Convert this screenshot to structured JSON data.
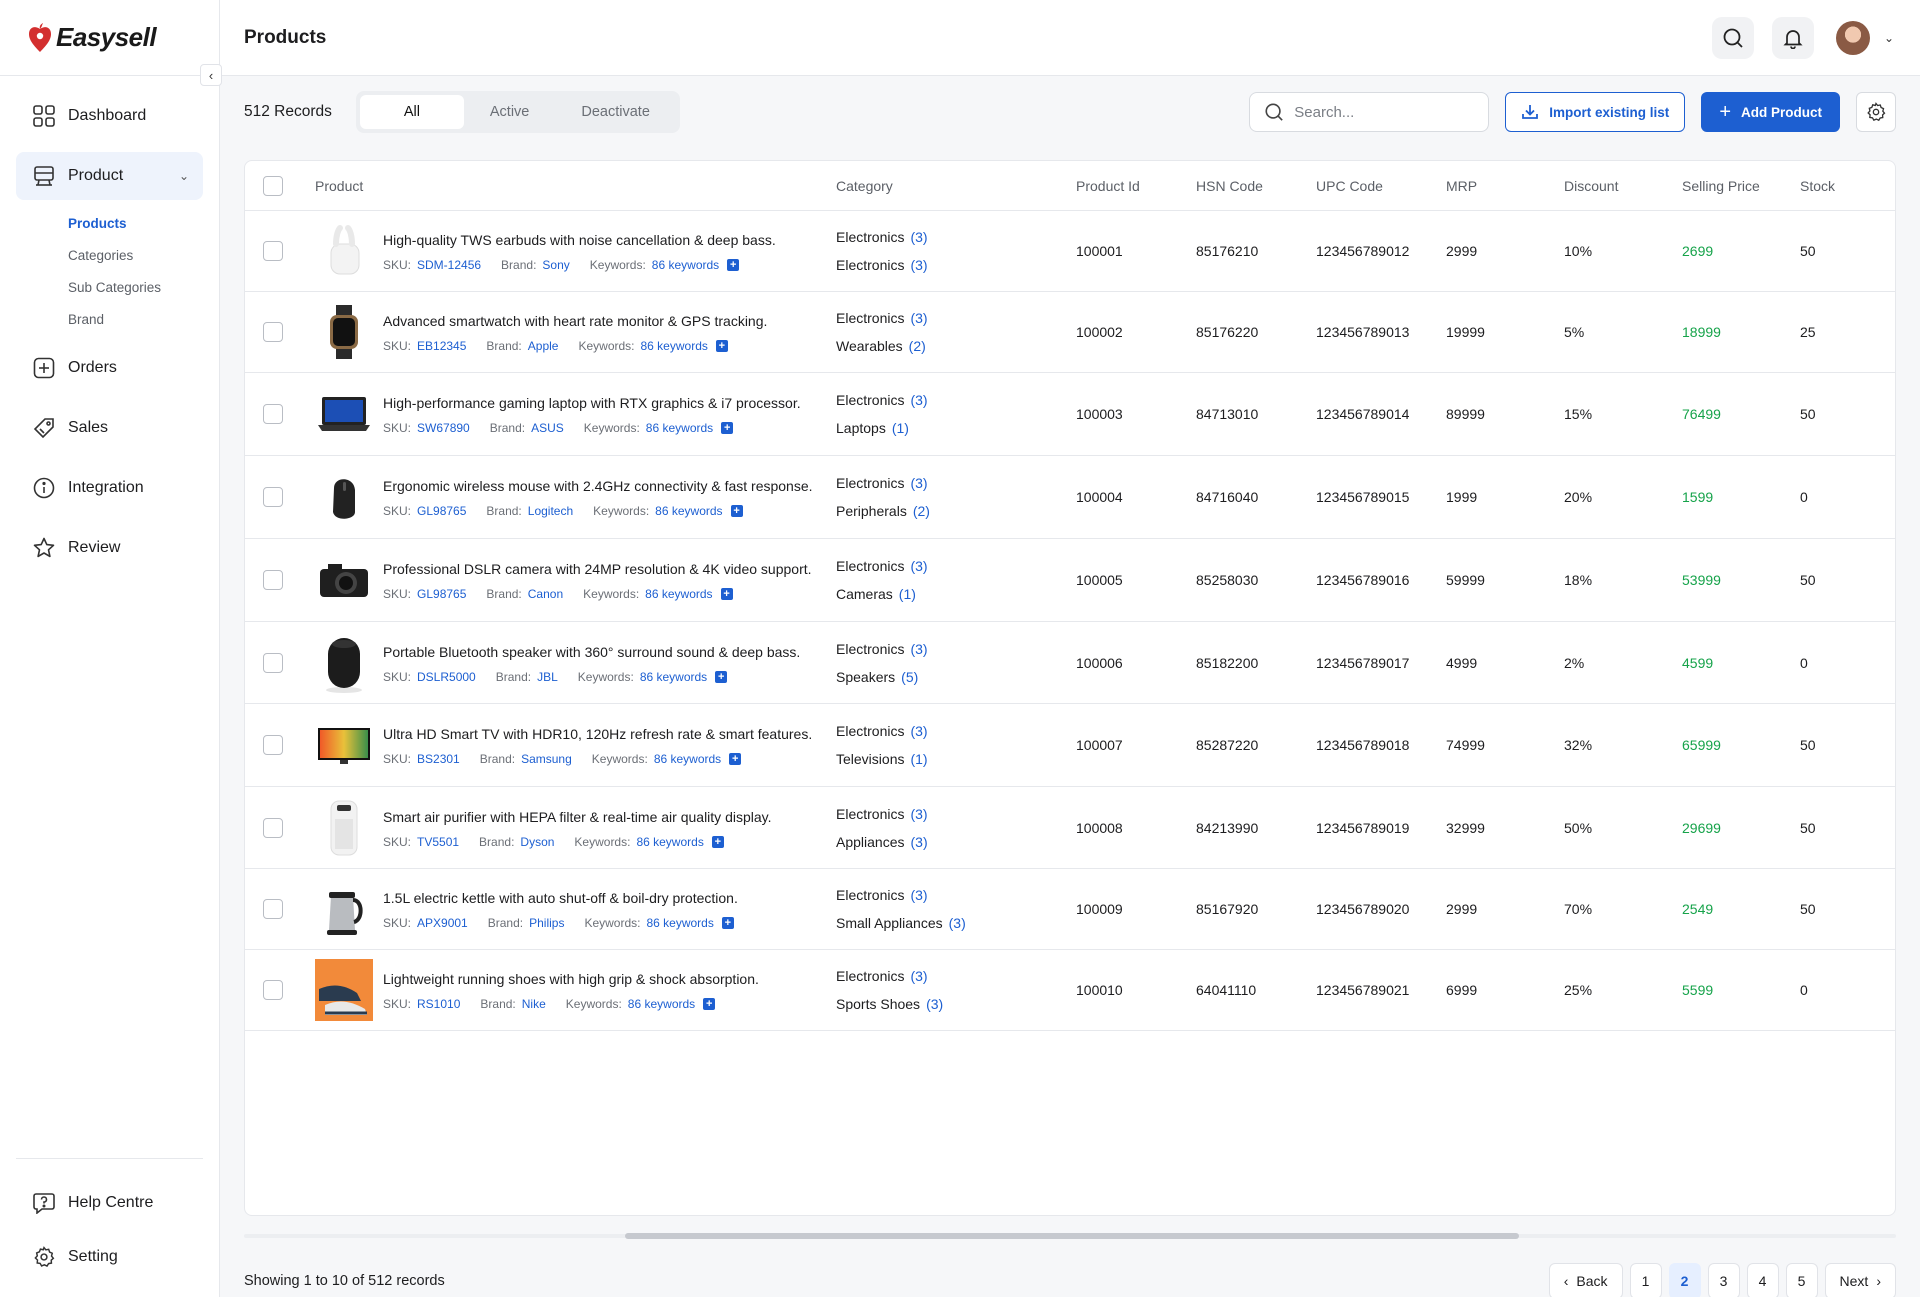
{
  "app": {
    "name": "Easysell",
    "page_title": "Products"
  },
  "sidebar": {
    "items": [
      {
        "label": "Dashboard",
        "icon": "grid-icon"
      },
      {
        "label": "Product",
        "icon": "product-icon"
      },
      {
        "label": "Orders",
        "icon": "plus-square-icon"
      },
      {
        "label": "Sales",
        "icon": "tag-icon"
      },
      {
        "label": "Integration",
        "icon": "info-icon"
      },
      {
        "label": "Review",
        "icon": "star-icon"
      }
    ],
    "product_sub": [
      "Products",
      "Categories",
      "Sub Categories",
      "Brand"
    ],
    "bottom": [
      {
        "label": "Help Centre",
        "icon": "help-icon"
      },
      {
        "label": "Setting",
        "icon": "gear-icon"
      }
    ]
  },
  "toolbar": {
    "records": "512 Records",
    "filters": [
      "All",
      "Active",
      "Deactivate"
    ],
    "search_placeholder": "Search...",
    "import_label": "Import existing list",
    "add_label": "Add Product"
  },
  "table": {
    "headers": [
      "Product",
      "Category",
      "Product Id",
      "HSN Code",
      "UPC Code",
      "MRP",
      "Discount",
      "Selling Price",
      "Stock"
    ],
    "meta_labels": {
      "sku": "SKU:",
      "brand": "Brand:",
      "keywords": "Keywords:"
    },
    "rows": [
      {
        "name": "High-quality TWS earbuds with noise cancellation & deep bass.",
        "sku": "SDM-12456",
        "brand": "Sony",
        "keywords": "86 keywords",
        "cat1": "Electronics",
        "cnt1": "(3)",
        "cat2": "Electronics",
        "cnt2": "(3)",
        "pid": "100001",
        "hsn": "85176210",
        "upc": "123456789012",
        "mrp": "2999",
        "disc": "10%",
        "sell": "2699",
        "stock": "50"
      },
      {
        "name": "Advanced smartwatch with heart rate monitor & GPS tracking.",
        "sku": "EB12345",
        "brand": "Apple",
        "keywords": "86 keywords",
        "cat1": "Electronics",
        "cnt1": "(3)",
        "cat2": "Wearables",
        "cnt2": "(2)",
        "pid": "100002",
        "hsn": "85176220",
        "upc": "123456789013",
        "mrp": "19999",
        "disc": "5%",
        "sell": "18999",
        "stock": "25"
      },
      {
        "name": "High-performance gaming laptop with RTX graphics & i7 processor.",
        "sku": "SW67890",
        "brand": "ASUS",
        "keywords": "86 keywords",
        "cat1": "Electronics",
        "cnt1": "(3)",
        "cat2": "Laptops",
        "cnt2": "(1)",
        "pid": "100003",
        "hsn": "84713010",
        "upc": "123456789014",
        "mrp": "89999",
        "disc": "15%",
        "sell": "76499",
        "stock": "50"
      },
      {
        "name": "Ergonomic wireless mouse with 2.4GHz connectivity & fast response.",
        "sku": "GL98765",
        "brand": "Logitech",
        "keywords": "86 keywords",
        "cat1": "Electronics",
        "cnt1": "(3)",
        "cat2": "Peripherals",
        "cnt2": "(2)",
        "pid": "100004",
        "hsn": "84716040",
        "upc": "123456789015",
        "mrp": "1999",
        "disc": "20%",
        "sell": "1599",
        "stock": "0"
      },
      {
        "name": "Professional DSLR camera with 24MP resolution & 4K video support.",
        "sku": "GL98765",
        "brand": "Canon",
        "keywords": "86 keywords",
        "cat1": "Electronics",
        "cnt1": "(3)",
        "cat2": "Cameras",
        "cnt2": "(1)",
        "pid": "100005",
        "hsn": "85258030",
        "upc": "123456789016",
        "mrp": "59999",
        "disc": "18%",
        "sell": "53999",
        "stock": "50"
      },
      {
        "name": "Portable Bluetooth speaker with 360° surround sound & deep bass.",
        "sku": "DSLR5000",
        "brand": "JBL",
        "keywords": "86 keywords",
        "cat1": "Electronics",
        "cnt1": "(3)",
        "cat2": "Speakers",
        "cnt2": "(5)",
        "pid": "100006",
        "hsn": "85182200",
        "upc": "123456789017",
        "mrp": "4999",
        "disc": "2%",
        "sell": "4599",
        "stock": "0"
      },
      {
        "name": "Ultra HD Smart TV with HDR10, 120Hz refresh rate & smart features.",
        "sku": "BS2301",
        "brand": "Samsung",
        "keywords": "86 keywords",
        "cat1": "Electronics",
        "cnt1": "(3)",
        "cat2": "Televisions",
        "cnt2": "(1)",
        "pid": "100007",
        "hsn": "85287220",
        "upc": "123456789018",
        "mrp": "74999",
        "disc": "32%",
        "sell": "65999",
        "stock": "50"
      },
      {
        "name": "Smart air purifier with HEPA filter & real-time air quality display.",
        "sku": "TV5501",
        "brand": "Dyson",
        "keywords": "86 keywords",
        "cat1": "Electronics",
        "cnt1": "(3)",
        "cat2": "Appliances",
        "cnt2": "(3)",
        "pid": "100008",
        "hsn": "84213990",
        "upc": "123456789019",
        "mrp": "32999",
        "disc": "50%",
        "sell": "29699",
        "stock": "50"
      },
      {
        "name": "1.5L electric kettle with auto shut-off & boil-dry protection.",
        "sku": "APX9001",
        "brand": "Philips",
        "keywords": "86 keywords",
        "cat1": "Electronics",
        "cnt1": "(3)",
        "cat2": "Small Appliances",
        "cnt2": "(3)",
        "pid": "100009",
        "hsn": "85167920",
        "upc": "123456789020",
        "mrp": "2999",
        "disc": "70%",
        "sell": "2549",
        "stock": "50"
      },
      {
        "name": "Lightweight running shoes with high grip & shock absorption.",
        "sku": "RS1010",
        "brand": "Nike",
        "keywords": "86 keywords",
        "cat1": "Electronics",
        "cnt1": "(3)",
        "cat2": "Sports Shoes",
        "cnt2": "(3)",
        "pid": "100010",
        "hsn": "64041110",
        "upc": "123456789021",
        "mrp": "6999",
        "disc": "25%",
        "sell": "5599",
        "stock": "0"
      }
    ]
  },
  "footer": {
    "showing": "Showing 1 to 10 of 512 records",
    "back": "Back",
    "next": "Next",
    "pages": [
      "1",
      "2",
      "3",
      "4",
      "5"
    ],
    "current_page": "2"
  },
  "colors": {
    "accent": "#1d5fd1",
    "selling": "#16a34a",
    "brand_logo": "#d32f2f"
  }
}
